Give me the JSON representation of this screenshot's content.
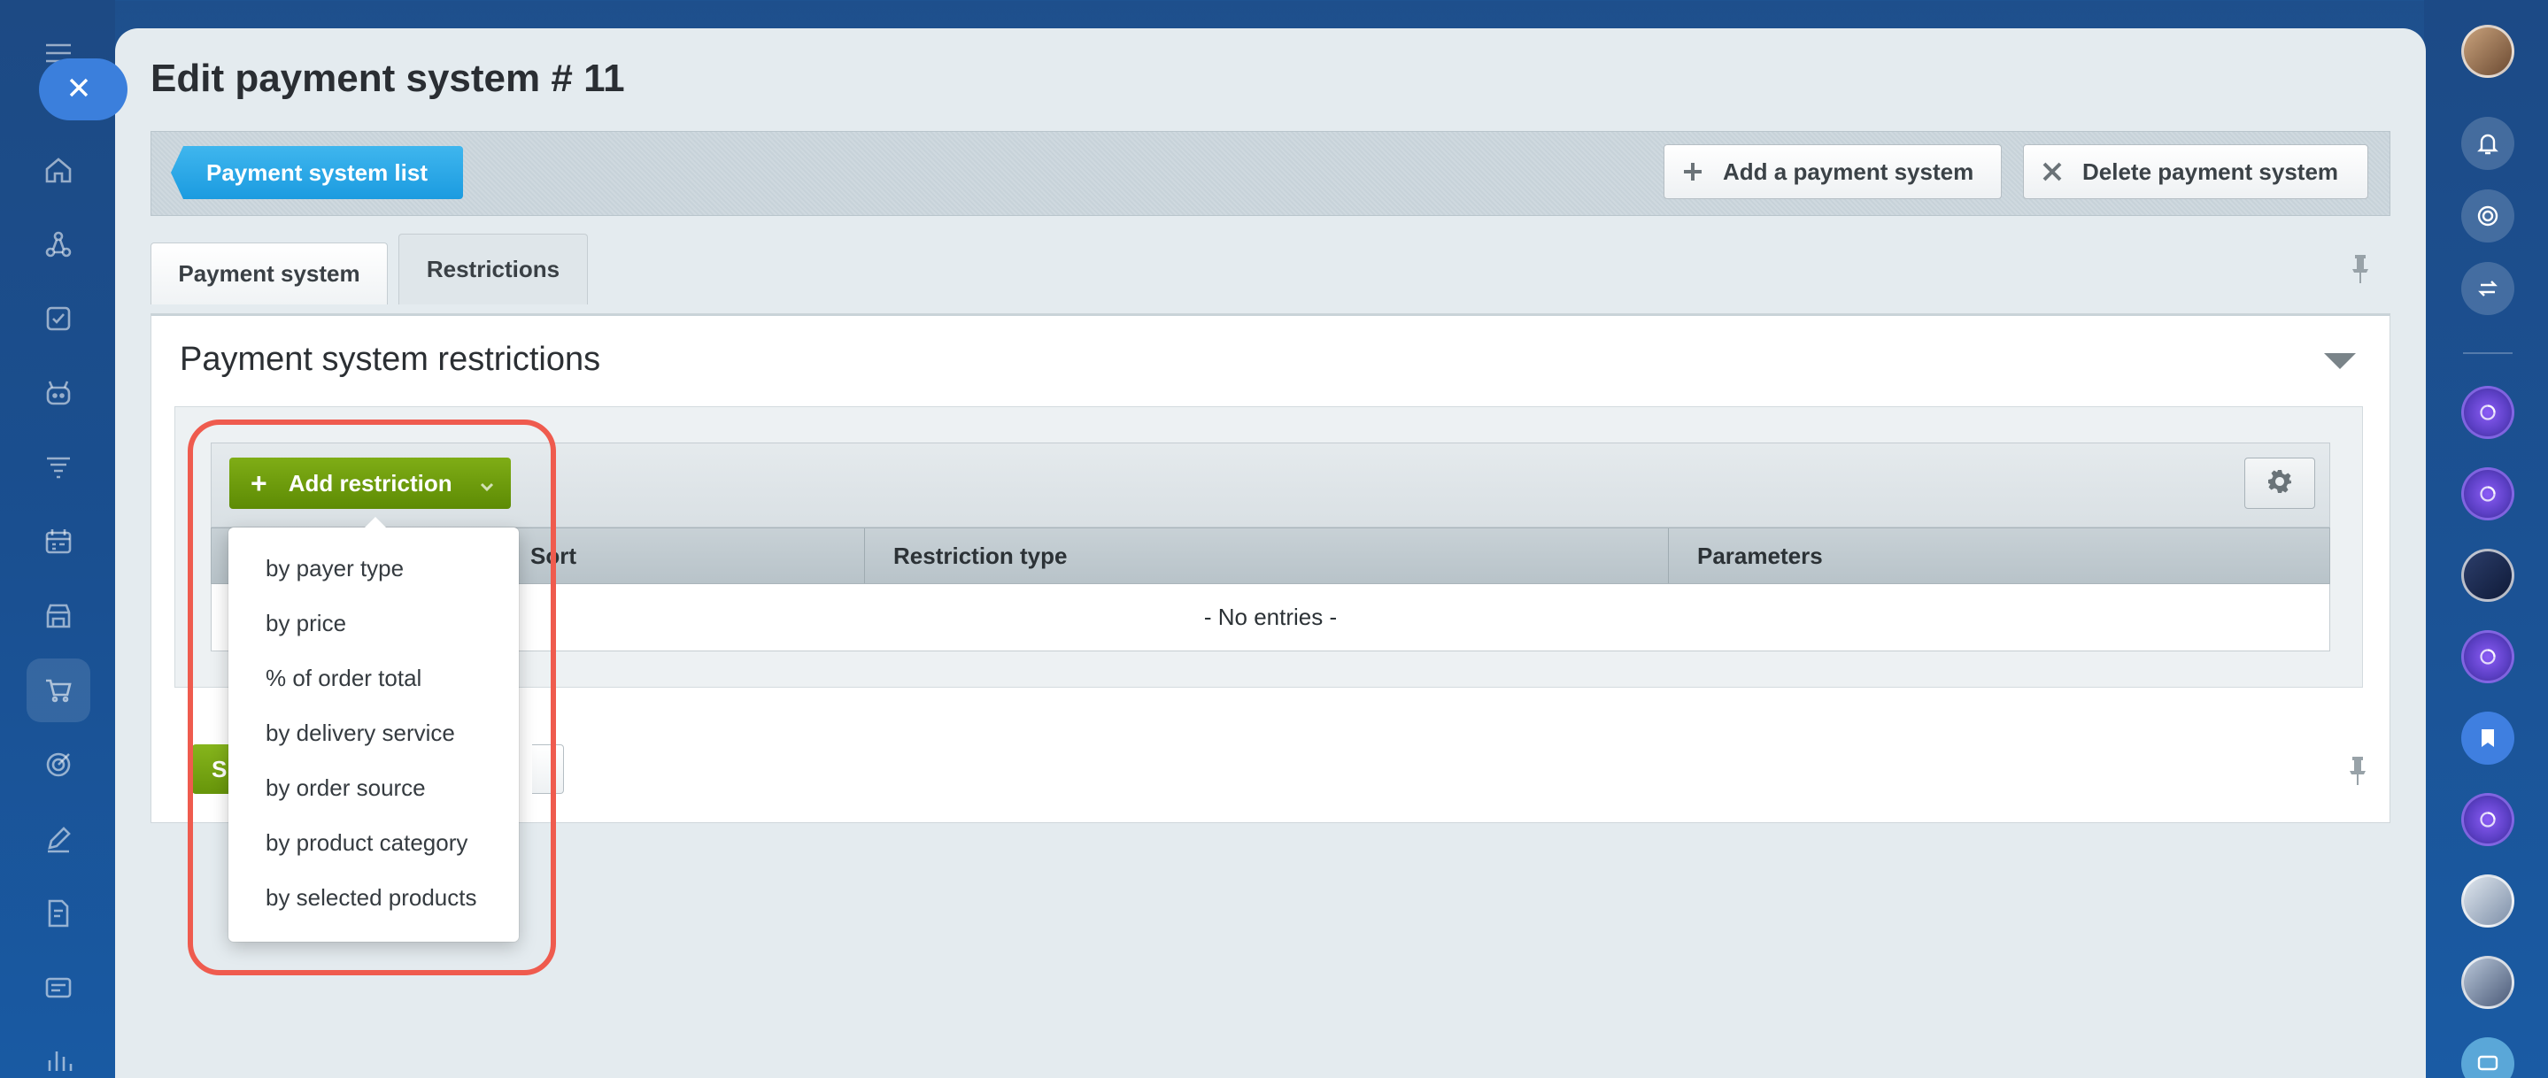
{
  "page": {
    "title": "Edit payment system # 11"
  },
  "toolbar": {
    "list_label": "Payment system list",
    "add_label": "Add a payment system",
    "delete_label": "Delete payment system"
  },
  "tabs": [
    {
      "label": "Payment system"
    },
    {
      "label": "Restrictions"
    }
  ],
  "section": {
    "title": "Payment system restrictions"
  },
  "grid": {
    "add_restriction_label": "Add restriction",
    "columns": [
      "Sort",
      "Restriction type",
      "Parameters"
    ],
    "empty_text": "- No entries -"
  },
  "footer": {
    "save_partial": "S"
  },
  "dropdown": {
    "items": [
      "by payer type",
      "by price",
      "% of order total",
      "by delivery service",
      "by order source",
      "by product category",
      "by selected products"
    ]
  },
  "colors": {
    "accent_blue": "#1b9be0",
    "add_green": "#5d8b04",
    "highlight_red": "#ef5b4e"
  }
}
